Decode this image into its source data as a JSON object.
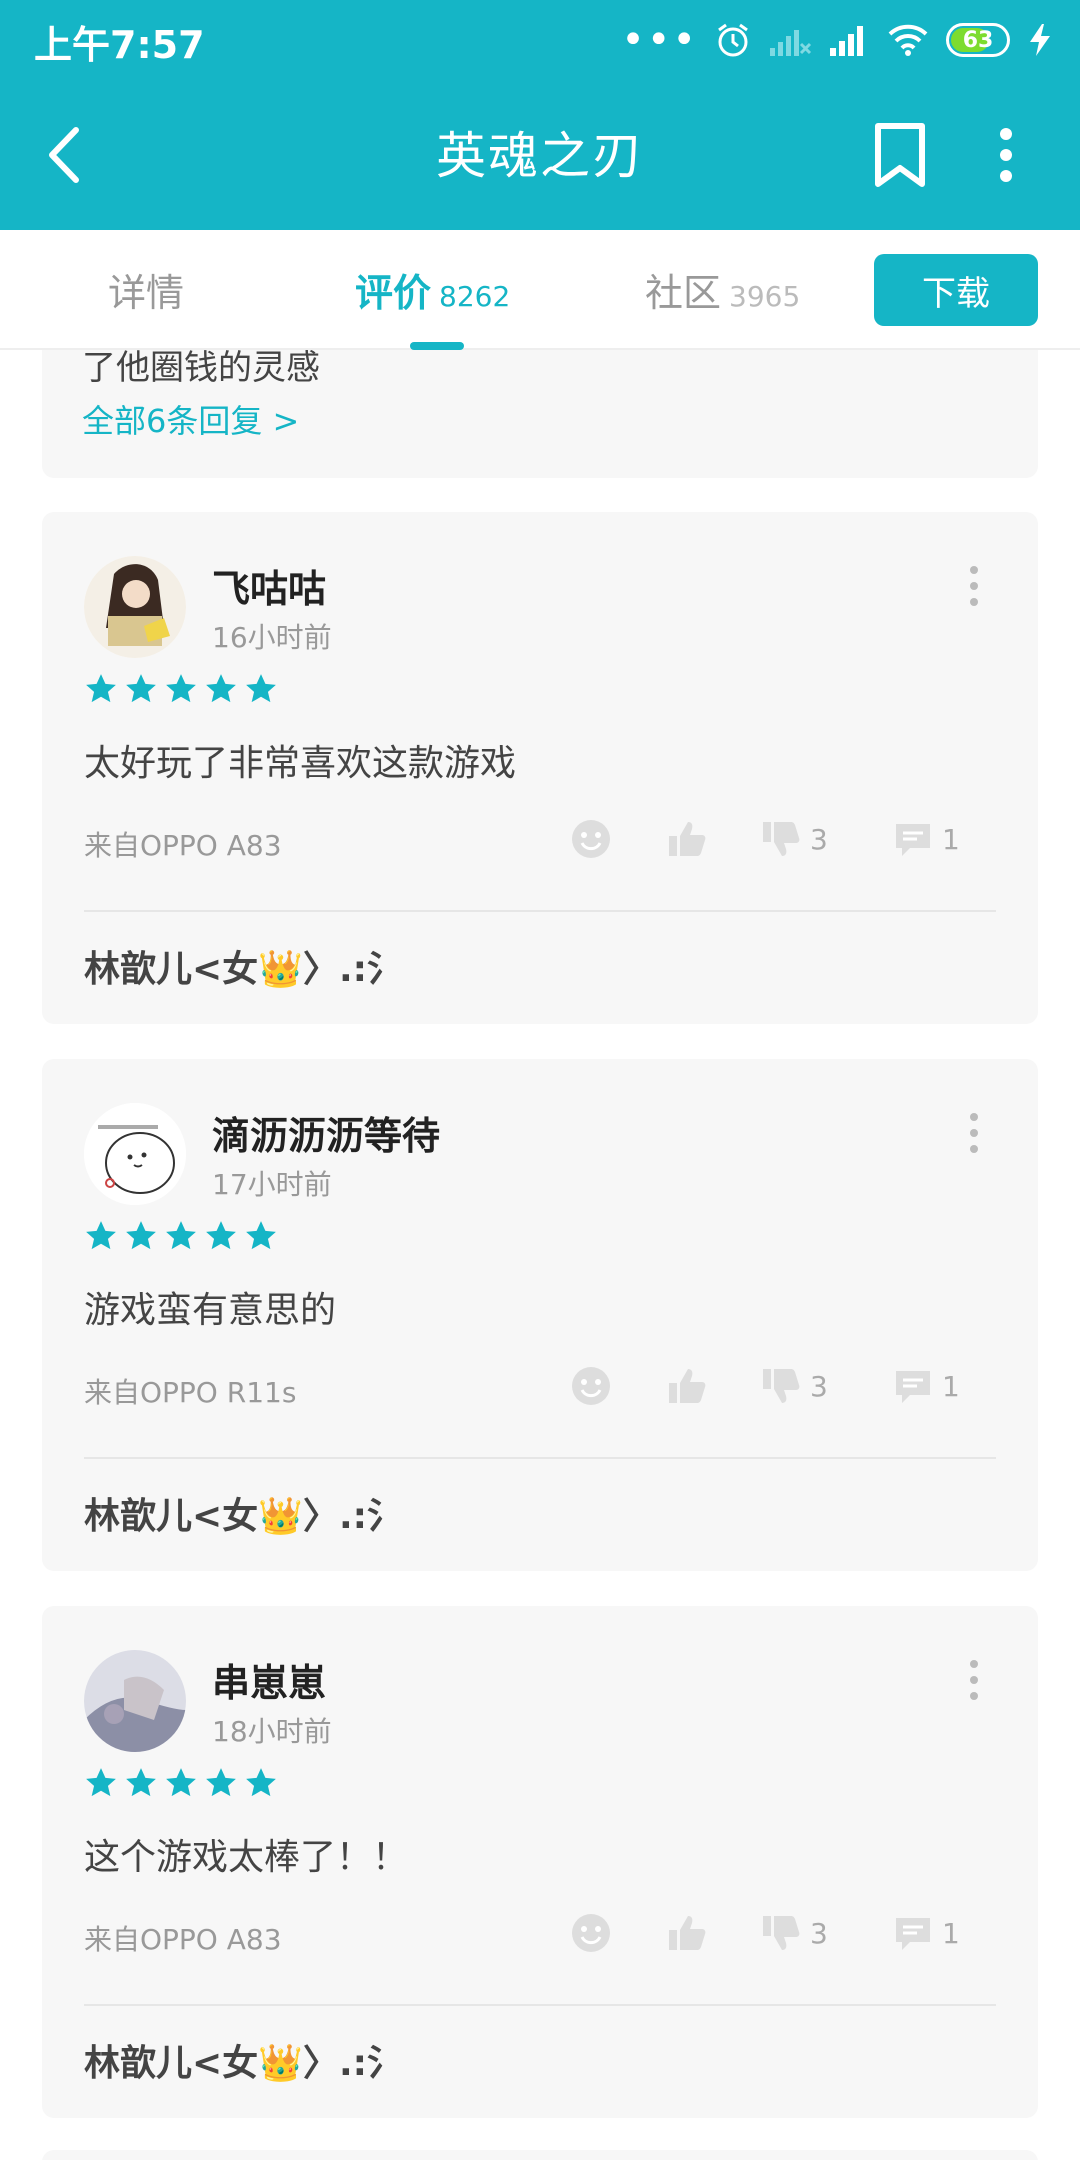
{
  "status_bar": {
    "time": "上午7:57",
    "dots": "•••",
    "battery": "63"
  },
  "header": {
    "title": "英魂之刃",
    "icons": [
      "back-arrow-icon",
      "bookmark-icon",
      "more-vert-icon"
    ]
  },
  "tabs": [
    {
      "label": "详情",
      "count": ""
    },
    {
      "label": "评价",
      "count": "8262"
    },
    {
      "label": "社区",
      "count": "3965"
    }
  ],
  "download_label": "下载",
  "prev_card": {
    "text": "了他圈钱的灵感",
    "replies_link": "全部6条回复 >"
  },
  "colors": {
    "accent": "#15b5c6",
    "card_bg": "#f7f7f7"
  },
  "reviews": [
    {
      "username": "飞咕咕",
      "time": "16小时前",
      "rating": 5,
      "text": "太好玩了非常喜欢这款游戏",
      "device": "来自OPPO A83",
      "dislikes": "3",
      "comments": "1",
      "reply_preview": "林歆儿<女👑〉.:氵"
    },
    {
      "username": "滴沥沥沥等待",
      "time": "17小时前",
      "rating": 5,
      "text": "游戏蛮有意思的",
      "device": "来自OPPO R11s",
      "dislikes": "3",
      "comments": "1",
      "reply_preview": "林歆儿<女👑〉.:氵"
    },
    {
      "username": "串崽崽",
      "time": "18小时前",
      "rating": 5,
      "text": "这个游戏太棒了！！",
      "device": "来自OPPO A83",
      "dislikes": "3",
      "comments": "1",
      "reply_preview": "林歆儿<女👑〉.:氵"
    }
  ]
}
